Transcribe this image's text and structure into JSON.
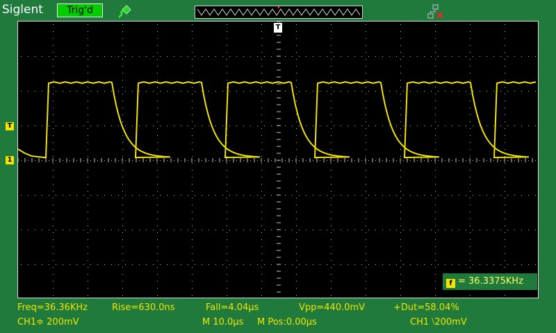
{
  "header": {
    "brand": "Siglent",
    "trigger_status": "Trig'd",
    "icons": [
      "probe-icon",
      "network-disconnected-icon"
    ]
  },
  "markers": {
    "trigger_level": "T",
    "channel_1": "1",
    "trigger_position": "T"
  },
  "frequency_counter": {
    "icon": "f",
    "value": "= 36.3375KHz"
  },
  "measurements": {
    "freq": "Freq=36.36KHz",
    "rise": "Rise=630.0ns",
    "fall": "Fall=4.04µs",
    "vpp": "Vpp=440.0mV",
    "duty": "+Dut=58.04%"
  },
  "status": {
    "ch1_scale": "CH1≑ 200mV",
    "timebase": "M 10.0µs",
    "position": "M Pos:0.00µs",
    "trigger_source": "CH1 ⧵200mV"
  },
  "colors": {
    "background": "#1f7a3c",
    "trace": "#f2e500",
    "grid": "#c8c8c8",
    "trig_badge": "#00cc00"
  }
}
